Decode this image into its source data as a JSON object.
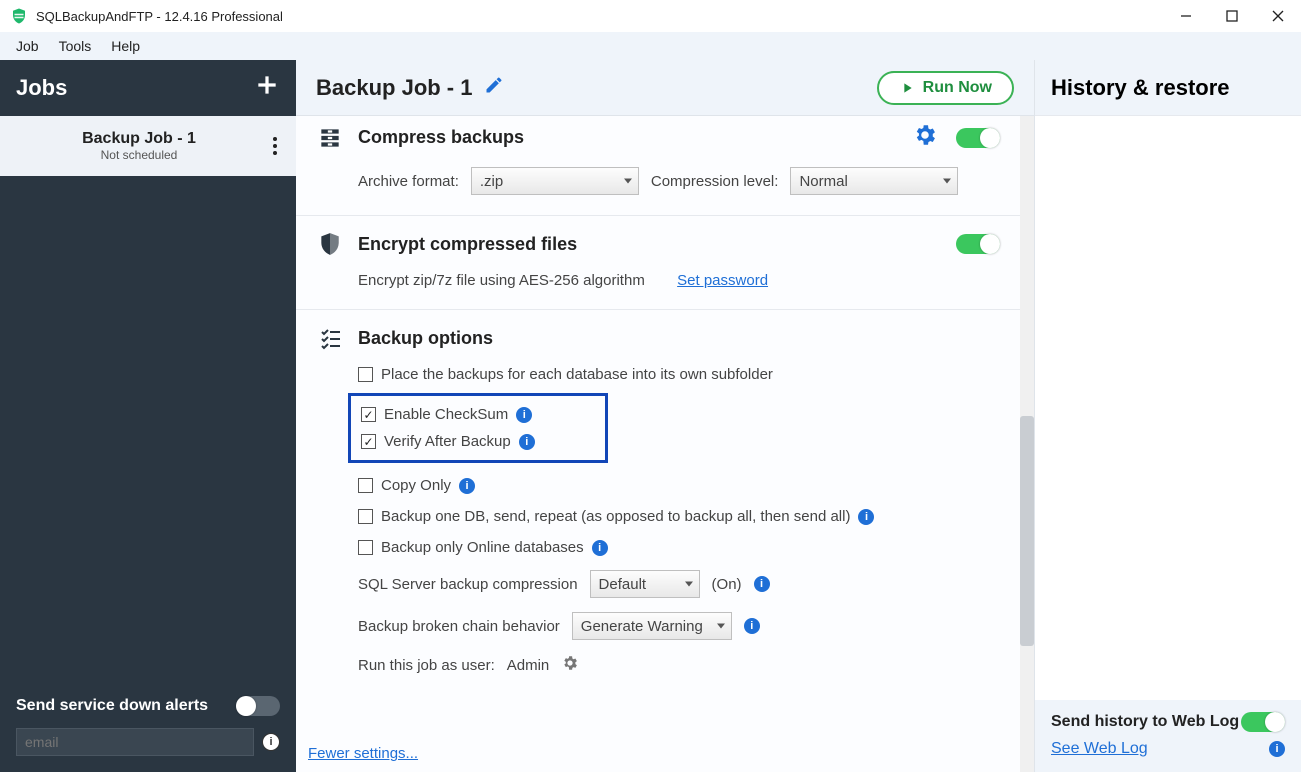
{
  "window": {
    "title": "SQLBackupAndFTP - 12.4.16 Professional"
  },
  "menu": {
    "items": [
      "Job",
      "Tools",
      "Help"
    ]
  },
  "sidebar": {
    "header": "Jobs",
    "job": {
      "name": "Backup Job - 1",
      "status": "Not scheduled"
    },
    "alerts": {
      "label": "Send service down alerts",
      "email_placeholder": "email"
    }
  },
  "main": {
    "title": "Backup Job - 1",
    "run_label": "Run Now",
    "compress": {
      "title": "Compress backups",
      "archive_label": "Archive format:",
      "archive_value": ".zip",
      "compression_label": "Compression level:",
      "compression_value": "Normal"
    },
    "encrypt": {
      "title": "Encrypt compressed files",
      "desc": "Encrypt zip/7z file using AES-256 algorithm",
      "set_password": "Set password"
    },
    "options": {
      "title": "Backup options",
      "subfolder": "Place the backups for each database into its own subfolder",
      "checksum": "Enable CheckSum",
      "verify": "Verify After Backup",
      "copy_only": "Copy Only",
      "one_db": "Backup one DB, send, repeat (as opposed to backup all, then send all)",
      "online_only": "Backup only Online databases",
      "compression_label": "SQL Server backup compression",
      "compression_value": "Default",
      "compression_hint": "(On)",
      "chain_label": "Backup broken chain behavior",
      "chain_value": "Generate Warning",
      "run_as_label": "Run this job as user:",
      "run_as_value": "Admin"
    },
    "fewer": "Fewer settings..."
  },
  "history": {
    "header": "History & restore",
    "footer_label": "Send history to Web Log",
    "see_log": "See Web Log"
  }
}
